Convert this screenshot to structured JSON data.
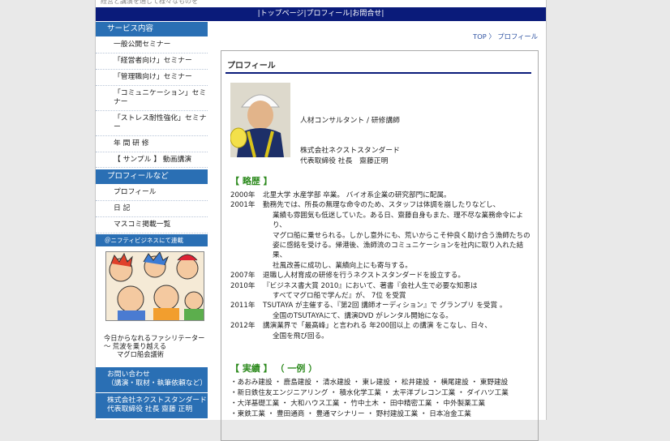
{
  "topstrip": "経営と講演を通じて様々なものを",
  "nav": {
    "top": "トップページ",
    "profile": "プロフィール",
    "contact": "お問合せ"
  },
  "sidebar": {
    "service_head": "サービス内容",
    "service_items": [
      "一般公開セミナー",
      "「経営者向け」セミナー",
      "「管理職向け」セミナー",
      "「コミュニケーション」セミナー",
      "「ストレス耐性強化」セミナー",
      "年 間 研 修",
      "【 サンプル 】 動画講演"
    ],
    "profile_head": "プロフィールなど",
    "profile_items": [
      "プロフィール",
      "日 記",
      "マスコミ掲載一覧"
    ],
    "banner_title": "＠ニフティビジネスにて連載",
    "banner_caption": [
      "今日からなれるファシリテーター",
      "〜 荒波を乗り越える",
      "マグロ船会議術"
    ],
    "contact_lines": [
      "お問い合わせ",
      "（講演・取材・執筆依頼など）"
    ],
    "company_lines": [
      "株式会社ネクストスタンダード",
      "代表取締役 社長 齋藤 正明"
    ]
  },
  "breadcrumb": {
    "top": "TOP",
    "sep": "〉",
    "current": "プロフィール"
  },
  "profile": {
    "title": "プロフィール",
    "role": "人材コンサルタント / 研修講師",
    "company": "株式会社ネクストスタンダード",
    "ceo": "代表取締役 社長　齋藤正明"
  },
  "history_title": "【 略歴 】",
  "history": [
    {
      "year": "2000年",
      "lines": [
        "北里大学 水産学部 卒業。 バイオ系企業の研究部門に配属。"
      ]
    },
    {
      "year": "2001年",
      "lines": [
        "勤務先では、所長の無理な命令のため、スタッフは体調を崩したりなどし、",
        "業績も雰囲気も低迷していた。ある日、齋藤自身もまた、理不尽な業務命令により、",
        "マグロ船に乗せられる。しかし意外にも、荒いからこそ仲良く助け合う漁師たちの",
        "姿に感銘を受ける。帰港後、漁師流のコミュニケーションを社内に取り入れた結果、",
        "社風改善に成功し、業績向上にも寄与する。"
      ]
    },
    {
      "year": "2007年",
      "lines": [
        "退職し人材育成の研修を行うネクストスタンダードを設立する。"
      ]
    },
    {
      "year": "2010年",
      "lines": [
        "『ビジネス書大賞 2010』において、著書『会社人生で必要な知恵は",
        "すべてマグロ船で学んだ』が、 7位 を受賞"
      ]
    },
    {
      "year": "2011年",
      "lines": [
        "TSUTAYA が主催する、『第2回 講師オーディション』で グランプリ を受賞 。",
        "全国のTSUTAYAにて、講演DVD がレンタル開始になる。"
      ]
    },
    {
      "year": "2012年",
      "lines": [
        "講演業界で「最高峰」と言われる 年200回以上 の講演 をこなし、日々、",
        "全国を飛び回る。"
      ]
    }
  ],
  "results_title": "【 実績 】 （ 一例 ）",
  "clients": [
    "・あおみ建設 ・ 鹿島建設 ・ 清水建設 ・ 東レ建設 ・ 松井建設 ・ 横尾建設 ・ 東野建設",
    "・新日鉄住友エンジニアリング ・ 積水化学工業 ・ 太平洋プレコン工業 ・ ダイハツ工業",
    "・大洋基礎工業 ・ 大和ハウス工業 ・ 竹中土木 ・ 田中精密工業 ・ 中外製薬工業",
    "・東鉄工業 ・ 豊田通商 ・ 豊通マシナリー ・ 野村建設工業 ・ 日本冶金工業"
  ],
  "colors": {
    "nav": "#0a1b7a",
    "sidebar_head": "#2a6fb4",
    "section_green": "#2e8b1f"
  }
}
